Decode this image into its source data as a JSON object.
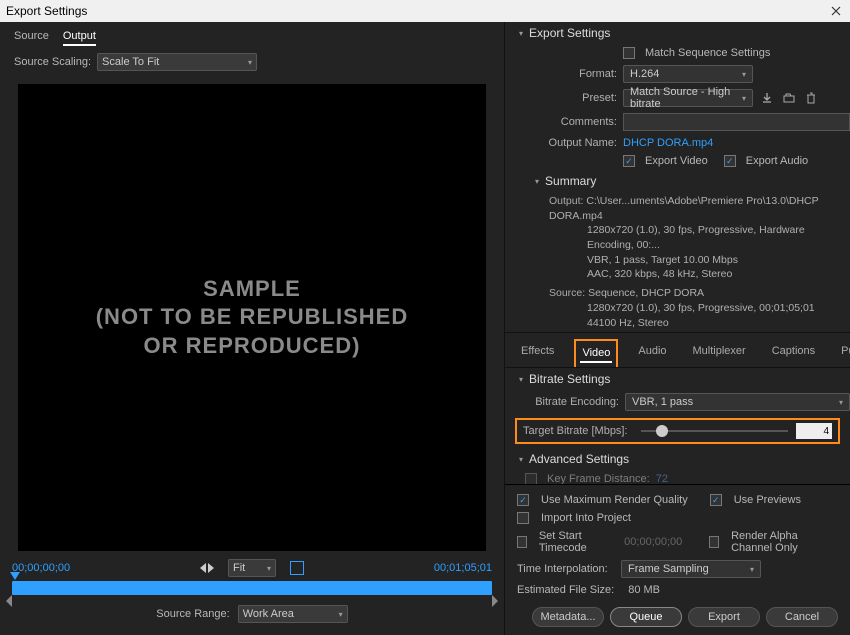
{
  "title": "Export Settings",
  "leftTabs": {
    "source": "Source",
    "output": "Output"
  },
  "sourceScaling": {
    "label": "Source Scaling:",
    "value": "Scale To Fit"
  },
  "preview": {
    "line1": "SAMPLE",
    "line2": "(NOT TO BE REPUBLISHED",
    "line3": "OR REPRODUCED)"
  },
  "timeline": {
    "in": "00;00;00;00",
    "out": "00;01;05;01",
    "fit": "Fit"
  },
  "sourceRange": {
    "label": "Source Range:",
    "value": "Work Area"
  },
  "export": {
    "heading": "Export Settings",
    "matchSeq": "Match Sequence Settings",
    "formatLabel": "Format:",
    "formatValue": "H.264",
    "presetLabel": "Preset:",
    "presetValue": "Match Source - High bitrate",
    "commentsLabel": "Comments:",
    "outputNameLabel": "Output Name:",
    "outputNameValue": "DHCP DORA.mp4",
    "exportVideo": "Export Video",
    "exportAudio": "Export Audio",
    "summaryHeading": "Summary",
    "summaryOutputLabel": "Output:",
    "summaryOutput1": "C:\\User...uments\\Adobe\\Premiere Pro\\13.0\\DHCP DORA.mp4",
    "summaryOutput2": "1280x720 (1.0), 30 fps, Progressive, Hardware Encoding, 00:...",
    "summaryOutput3": "VBR, 1 pass, Target 10.00 Mbps",
    "summaryOutput4": "AAC, 320 kbps, 48 kHz, Stereo",
    "summarySourceLabel": "Source:",
    "summarySource1": "Sequence, DHCP DORA",
    "summarySource2": "1280x720 (1.0), 30 fps, Progressive, 00;01;05;01",
    "summarySource3": "44100 Hz, Stereo"
  },
  "midTabs": {
    "effects": "Effects",
    "video": "Video",
    "audio": "Audio",
    "multiplexer": "Multiplexer",
    "captions": "Captions",
    "publish": "Publish"
  },
  "bitrate": {
    "heading": "Bitrate Settings",
    "encodingLabel": "Bitrate Encoding:",
    "encodingValue": "VBR, 1 pass",
    "targetLabel": "Target Bitrate [Mbps]:",
    "targetValue": "4"
  },
  "advanced": {
    "heading": "Advanced Settings",
    "keyframeLabel": "Key Frame Distance:",
    "keyframeValue": "72"
  },
  "bottom": {
    "useMaxRender": "Use Maximum Render Quality",
    "usePreviews": "Use Previews",
    "importProject": "Import Into Project",
    "setStartTC": "Set Start Timecode",
    "startTCValue": "00;00;00;00",
    "renderAlpha": "Render Alpha Channel Only",
    "timeInterpLabel": "Time Interpolation:",
    "timeInterpValue": "Frame Sampling",
    "estSizeLabel": "Estimated File Size:",
    "estSizeValue": "80 MB",
    "metadata": "Metadata...",
    "queue": "Queue",
    "export": "Export",
    "cancel": "Cancel"
  }
}
